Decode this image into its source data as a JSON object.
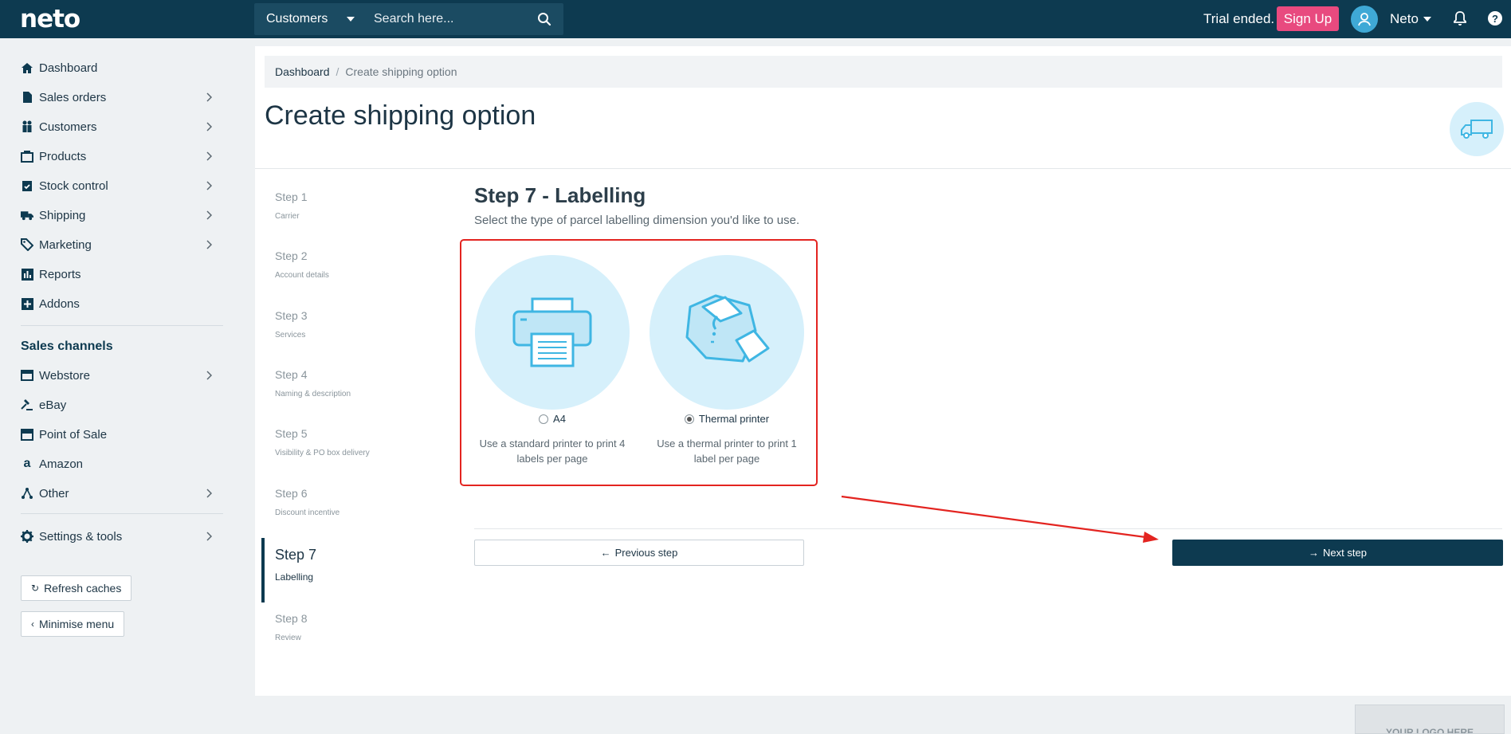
{
  "topbar": {
    "logo": "neto",
    "search_scope": "Customers",
    "search_placeholder": "Search here...",
    "trial_text": "Trial ended.",
    "signup_label": "Sign Up",
    "user_name": "Neto"
  },
  "sidebar": {
    "items": [
      {
        "label": "Dashboard",
        "icon": "home-icon",
        "has_children": false
      },
      {
        "label": "Sales orders",
        "icon": "document-icon",
        "has_children": true
      },
      {
        "label": "Customers",
        "icon": "people-icon",
        "has_children": true
      },
      {
        "label": "Products",
        "icon": "tag-box-icon",
        "has_children": true
      },
      {
        "label": "Stock control",
        "icon": "clipboard-check-icon",
        "has_children": true
      },
      {
        "label": "Shipping",
        "icon": "truck-icon",
        "has_children": true
      },
      {
        "label": "Marketing",
        "icon": "tag-icon",
        "has_children": true
      },
      {
        "label": "Reports",
        "icon": "bar-chart-icon",
        "has_children": false
      },
      {
        "label": "Addons",
        "icon": "plus-box-icon",
        "has_children": false
      }
    ],
    "sales_channels_title": "Sales channels",
    "channels": [
      {
        "label": "Webstore",
        "icon": "browser-icon",
        "has_children": true
      },
      {
        "label": "eBay",
        "icon": "gavel-icon",
        "has_children": false
      },
      {
        "label": "Point of Sale",
        "icon": "store-icon",
        "has_children": false
      },
      {
        "label": "Amazon",
        "icon": "amazon-icon",
        "has_children": false
      },
      {
        "label": "Other",
        "icon": "network-icon",
        "has_children": true
      }
    ],
    "settings_label": "Settings & tools",
    "refresh_label": "Refresh caches",
    "minimise_label": "Minimise menu"
  },
  "main": {
    "breadcrumb": {
      "home": "Dashboard",
      "current": "Create shipping option"
    },
    "page_title": "Create shipping option",
    "steps": [
      {
        "num": "Step 1",
        "sub": "Carrier"
      },
      {
        "num": "Step 2",
        "sub": "Account details"
      },
      {
        "num": "Step 3",
        "sub": "Services"
      },
      {
        "num": "Step 4",
        "sub": "Naming & description"
      },
      {
        "num": "Step 5",
        "sub": "Visibility & PO box delivery"
      },
      {
        "num": "Step 6",
        "sub": "Discount incentive"
      },
      {
        "num": "Step 7",
        "sub": "Labelling"
      },
      {
        "num": "Step 8",
        "sub": "Review"
      }
    ],
    "active_step": 7,
    "content_title": "Step 7 - Labelling",
    "content_subtitle": "Select the type of parcel labelling dimension you'd like to use.",
    "options": [
      {
        "label": "A4",
        "desc": "Use a standard printer to print 4 labels per page",
        "selected": false
      },
      {
        "label": "Thermal printer",
        "desc": "Use a thermal printer to print 1 label per page",
        "selected": true
      }
    ],
    "prev_label": "Previous step",
    "next_label": "Next step"
  },
  "footer": {
    "logo_placeholder": "YOUR LOGO HERE"
  },
  "colors": {
    "navy": "#0d3a50",
    "pink": "#e84a7f",
    "light_blue": "#d6f0fb",
    "icon_blue": "#3fb6e3",
    "annotation_red": "#e32420"
  }
}
